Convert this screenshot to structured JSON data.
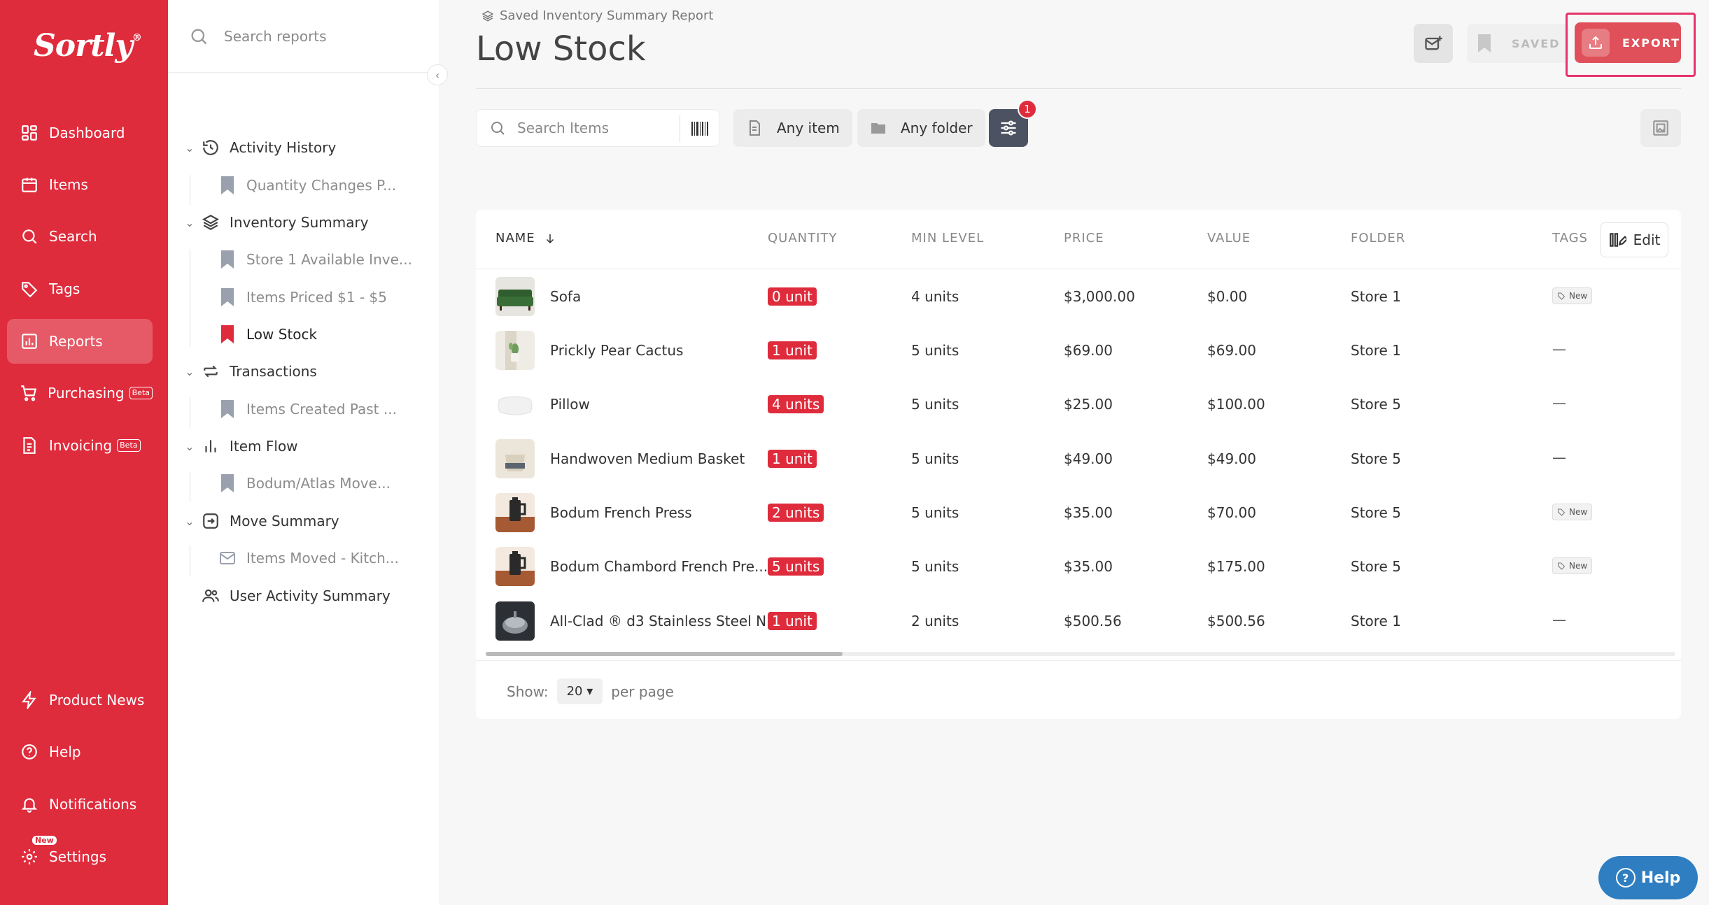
{
  "app": {
    "logo": "Sortly",
    "logo_mark": "®"
  },
  "sidebar": {
    "items": [
      {
        "label": "Dashboard",
        "icon": "dashboard-icon"
      },
      {
        "label": "Items",
        "icon": "items-icon"
      },
      {
        "label": "Search",
        "icon": "search-icon"
      },
      {
        "label": "Tags",
        "icon": "tag-icon"
      },
      {
        "label": "Reports",
        "icon": "reports-icon",
        "active": true
      },
      {
        "label": "Purchasing",
        "icon": "cart-icon",
        "badge": "Beta"
      },
      {
        "label": "Invoicing",
        "icon": "invoice-icon",
        "badge": "Beta"
      }
    ],
    "bottom": [
      {
        "label": "Product News",
        "icon": "bolt-icon"
      },
      {
        "label": "Help",
        "icon": "help-icon"
      },
      {
        "label": "Notifications",
        "icon": "bell-icon"
      },
      {
        "label": "Settings",
        "icon": "gear-icon",
        "badge": "New"
      }
    ]
  },
  "reports_panel": {
    "search_placeholder": "Search reports",
    "groups": [
      {
        "label": "Activity History",
        "children": [
          "Quantity Changes P..."
        ]
      },
      {
        "label": "Inventory Summary",
        "children": [
          "Store 1 Available Inve...",
          "Items Priced $1 - $5",
          "Low Stock"
        ]
      },
      {
        "label": "Transactions",
        "children": [
          "Items Created Past ..."
        ]
      },
      {
        "label": "Item Flow",
        "children": [
          "Bodum/Atlas Move..."
        ]
      },
      {
        "label": "Move Summary",
        "children": [
          "Items Moved - Kitch..."
        ]
      },
      {
        "label": "User Activity Summary",
        "children": []
      }
    ],
    "active_child": "Low Stock"
  },
  "header": {
    "breadcrumb": "Saved Inventory Summary Report",
    "title": "Low Stock",
    "saved_label": "SAVED",
    "export_label": "EXPORT"
  },
  "filters": {
    "search_placeholder": "Search Items",
    "item_filter": "Any item",
    "folder_filter": "Any folder",
    "active_filter_count": "1"
  },
  "table": {
    "columns": [
      "NAME",
      "QUANTITY",
      "MIN LEVEL",
      "PRICE",
      "VALUE",
      "FOLDER",
      "TAGS"
    ],
    "edit_label": "Edit",
    "rows": [
      {
        "name": "Sofa",
        "qty": "0 unit",
        "min": "4 units",
        "price": "$3,000.00",
        "value": "$0.00",
        "folder": "Store 1",
        "tag": "New"
      },
      {
        "name": "Prickly Pear Cactus",
        "qty": "1 unit",
        "min": "5 units",
        "price": "$69.00",
        "value": "$69.00",
        "folder": "Store 1",
        "tag": "—"
      },
      {
        "name": "Pillow",
        "qty": "4 units",
        "min": "5 units",
        "price": "$25.00",
        "value": "$100.00",
        "folder": "Store 5",
        "tag": "—"
      },
      {
        "name": "Handwoven Medium Basket",
        "qty": "1 unit",
        "min": "5 units",
        "price": "$49.00",
        "value": "$49.00",
        "folder": "Store 5",
        "tag": "—"
      },
      {
        "name": "Bodum French Press",
        "qty": "2 units",
        "min": "5 units",
        "price": "$35.00",
        "value": "$70.00",
        "folder": "Store 5",
        "tag": "New"
      },
      {
        "name": "Bodum Chambord French Pre...",
        "qty": "5 units",
        "min": "5 units",
        "price": "$35.00",
        "value": "$175.00",
        "folder": "Store 5",
        "tag": "New"
      },
      {
        "name": "All-Clad ® d3 Stainless Steel N...",
        "qty": "1 unit",
        "min": "2 units",
        "price": "$500.56",
        "value": "$500.56",
        "folder": "Store 1",
        "tag": "—"
      }
    ]
  },
  "pagination": {
    "show_label": "Show:",
    "per_page_value": "20",
    "per_page_label": "per page"
  },
  "help_button": {
    "label": "Help"
  },
  "colors": {
    "brand": "#df2c3d",
    "export_highlight": "#e6336b",
    "filter_button": "#4d5263",
    "help_fab": "#2f7ec1"
  }
}
